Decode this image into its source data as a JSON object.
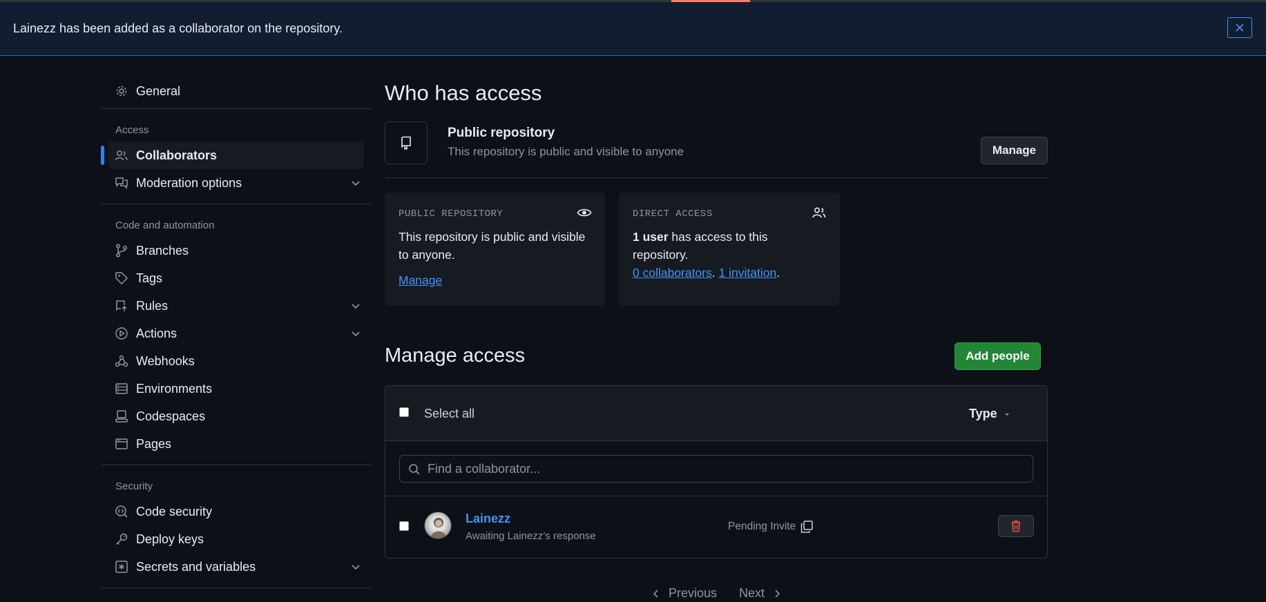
{
  "flash": {
    "message": "Lainezz has been added as a collaborator on the repository.",
    "close_icon": "x-icon"
  },
  "sidebar": {
    "general": "General",
    "access_heading": "Access",
    "collaborators": "Collaborators",
    "moderation": "Moderation options",
    "code_heading": "Code and automation",
    "branches": "Branches",
    "tags": "Tags",
    "rules": "Rules",
    "actions": "Actions",
    "webhooks": "Webhooks",
    "environments": "Environments",
    "codespaces": "Codespaces",
    "pages": "Pages",
    "security_heading": "Security",
    "code_security": "Code security",
    "deploy_keys": "Deploy keys",
    "secrets": "Secrets and variables"
  },
  "who": {
    "heading": "Who has access",
    "repo_title": "Public repository",
    "repo_desc": "This repository is public and visible to anyone",
    "manage_button": "Manage"
  },
  "cards": {
    "public": {
      "label": "PUBLIC REPOSITORY",
      "body": "This repository is public and visible to anyone.",
      "link": "Manage"
    },
    "direct": {
      "label": "DIRECT ACCESS",
      "users_bold": "1 user",
      "users_rest": " has access to this repository.",
      "collaborators_link": "0 collaborators",
      "sep": ". ",
      "invitation_link": "1 invitation",
      "end": "."
    }
  },
  "manage": {
    "heading": "Manage access",
    "add_button": "Add people",
    "select_all": "Select all",
    "type_filter": "Type",
    "search_placeholder": "Find a collaborator...",
    "rows": [
      {
        "name": "Lainezz",
        "subtitle": "Awaiting Lainezz’s response",
        "status": "Pending Invite"
      }
    ]
  },
  "pagination": {
    "previous": "Previous",
    "next": "Next"
  },
  "colors": {
    "background": "#0d1117",
    "accent": "#2f81f7",
    "link": "#4493f8",
    "primary_button": "#238636",
    "danger": "#f85149",
    "top_accent": "#f78166"
  }
}
